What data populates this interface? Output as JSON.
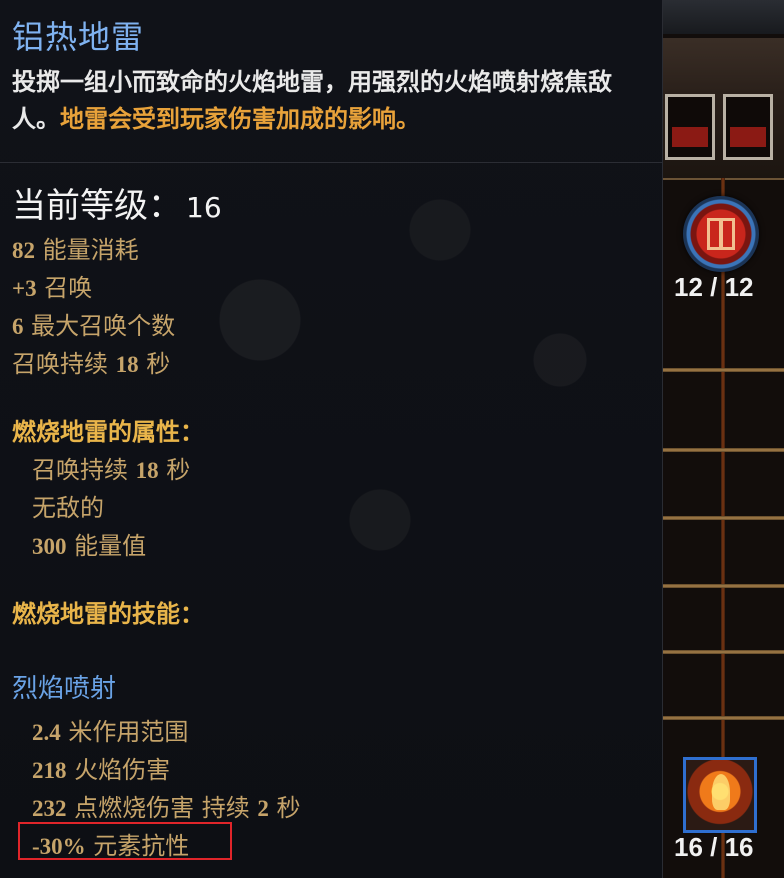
{
  "skill": {
    "title": "铝热地雷",
    "description_main": "投掷一组小而致命的火焰地雷，用强烈的火焰喷射烧焦敌人。",
    "description_highlight": "地雷会受到玩家伤害加成的影响。"
  },
  "level": {
    "label": "当前等级：",
    "value": "16"
  },
  "stats": [
    {
      "num": "82",
      "text": " 能量消耗"
    },
    {
      "num": "+3",
      "text": " 召唤"
    },
    {
      "num": "6",
      "text": " 最大召唤个数"
    },
    {
      "pre": "召唤持续 ",
      "num": "18",
      "text": " 秒"
    }
  ],
  "mine_props": {
    "header": "燃烧地雷的属性：",
    "items": [
      {
        "pre": "召唤持续 ",
        "num": "18",
        "text": " 秒"
      },
      {
        "pre": "无敌的",
        "num": "",
        "text": ""
      },
      {
        "pre": "",
        "num": "300",
        "text": " 能量值"
      }
    ]
  },
  "mine_skills": {
    "header": "燃烧地雷的技能："
  },
  "subskill": {
    "name": "烈焰喷射",
    "items": [
      {
        "num": "2.4",
        "text": " 米作用范围",
        "pre": "",
        "post_num": "",
        "post": ""
      },
      {
        "num": "218",
        "text": " 火焰伤害",
        "pre": "",
        "post_num": "",
        "post": ""
      },
      {
        "num": "232",
        "text": " 点燃烧伤害 持续 ",
        "pre": "",
        "post_num": "2",
        "post": " 秒"
      },
      {
        "num": "-30%",
        "text": " 元素抗性",
        "pre": "",
        "post_num": "",
        "post": ""
      }
    ]
  },
  "hud": {
    "slot1": {
      "icon": "rune-orb-icon",
      "current": "12",
      "sep": " / ",
      "max": "12"
    },
    "slot2": {
      "icon": "fire-skill-icon",
      "current": "16",
      "sep": " / ",
      "max": "16"
    }
  },
  "colors": {
    "title": "#7fb2f0",
    "highlight": "#e8a23a",
    "section": "#e9b54a",
    "stat": "#c6a46a",
    "subskill": "#6aa3e6",
    "box": "#e0252a"
  }
}
